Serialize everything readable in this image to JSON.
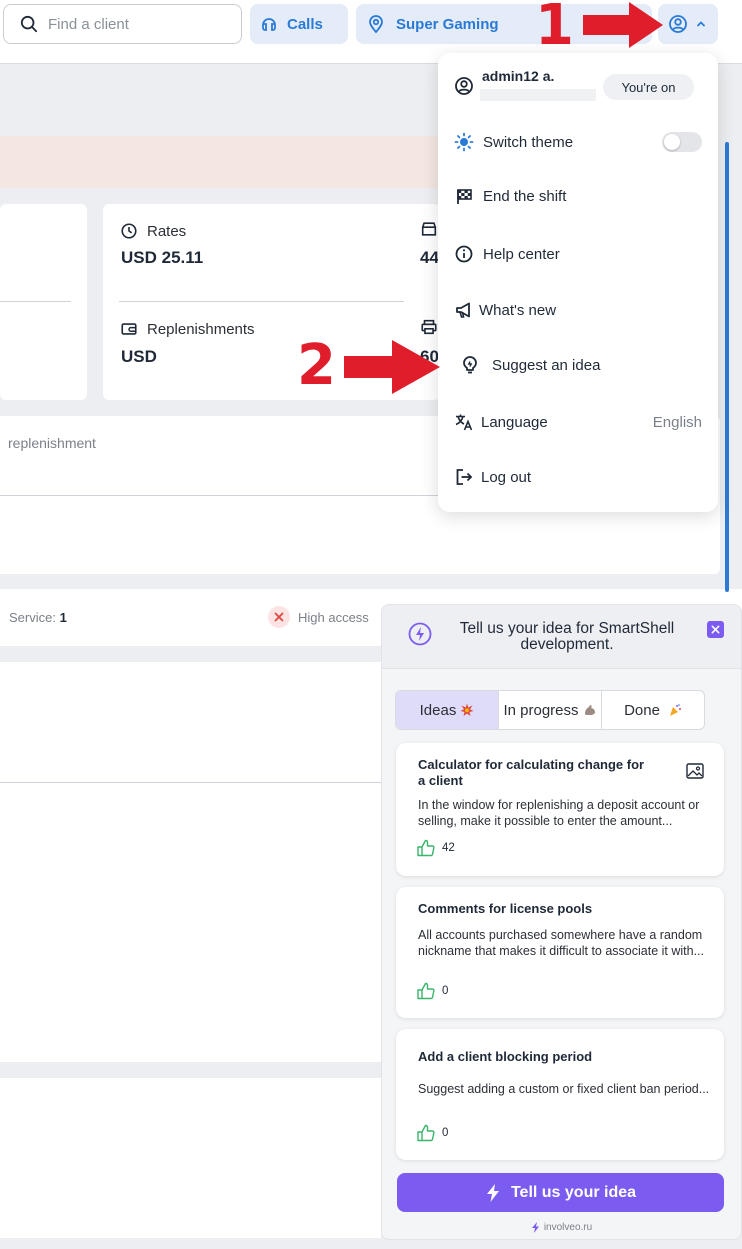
{
  "topbar": {
    "search_placeholder": "Find a client",
    "calls_label": "Calls",
    "club_label": "Super Gaming"
  },
  "stats": {
    "rates_label": "Rates",
    "rates_value": "USD 25.11",
    "replenishments_label": "Replenishments",
    "replenishments_value": "USD",
    "partial_value_1": "44",
    "partial_value_2": "60"
  },
  "content": {
    "replenishment_text": "replenishment",
    "service_label": "Service:",
    "service_value": "1",
    "high_access_label": "High access"
  },
  "user_menu": {
    "username": "admin12 a.",
    "status_badge": "You're on",
    "items": [
      {
        "label": "Switch theme"
      },
      {
        "label": "End the shift"
      },
      {
        "label": "Help center"
      },
      {
        "label": "What's new"
      },
      {
        "label": "Suggest an idea"
      },
      {
        "label": "Language",
        "value": "English"
      },
      {
        "label": "Log out"
      }
    ]
  },
  "annotations": {
    "step1": "1",
    "step2": "2",
    "arrow_color": "#e01e2b"
  },
  "ideas_widget": {
    "title": "Tell us your idea for SmartShell development.",
    "tabs": [
      {
        "label": "Ideas",
        "active": true,
        "emoji": "explosion-icon"
      },
      {
        "label": "In progress",
        "active": false,
        "emoji": "muscle-icon"
      },
      {
        "label": "Done",
        "active": false,
        "emoji": "party-icon"
      }
    ],
    "ideas": [
      {
        "title": "Calculator for calculating change for a client",
        "text": "In the window for replenishing a deposit account or selling, make it possible to enter the amount...",
        "likes": "42",
        "has_image": true
      },
      {
        "title": "Comments for license pools",
        "text": "All accounts purchased somewhere have a random nickname that makes it difficult to associate it with...",
        "likes": "0",
        "has_image": false
      },
      {
        "title": "Add a client blocking period",
        "text": "Suggest adding a custom or fixed client ban period...",
        "likes": "0",
        "has_image": false
      }
    ],
    "cta_label": "Tell us your idea",
    "footer_text": "involveo.ru",
    "accent_color": "#7c5cf0"
  },
  "colors": {
    "primary_blue": "#2b7ad6",
    "pill_background": "#e3ecf8",
    "active_tab_background": "#dedcf8"
  }
}
